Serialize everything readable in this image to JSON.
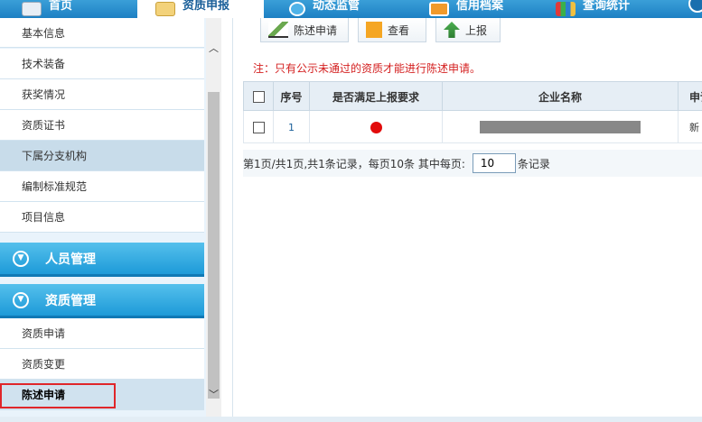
{
  "top_tabs": [
    {
      "label": "首页",
      "icon": "home-icon"
    },
    {
      "label": "资质申报",
      "icon": "pencil-icon"
    },
    {
      "label": "动态监管",
      "icon": "globe-icon"
    },
    {
      "label": "信用档案",
      "icon": "folder-icon"
    },
    {
      "label": "查询统计",
      "icon": "bar-chart-icon"
    }
  ],
  "sidebar": {
    "items_top": [
      {
        "label": "基本信息"
      },
      {
        "label": "技术装备"
      },
      {
        "label": "获奖情况"
      },
      {
        "label": "资质证书"
      },
      {
        "label": "下属分支机构"
      },
      {
        "label": "编制标准规范"
      },
      {
        "label": "项目信息"
      }
    ],
    "sections": [
      {
        "label": "人员管理"
      },
      {
        "label": "资质管理"
      }
    ],
    "items_bottom": [
      {
        "label": "资质申请"
      },
      {
        "label": "资质变更"
      },
      {
        "label": "陈述申请"
      }
    ]
  },
  "toolbar": {
    "statement_label": "陈述申请",
    "view_label": "查看",
    "report_label": "上报"
  },
  "notice": "注：只有公示未通过的资质才能进行陈述申请。",
  "table": {
    "columns": [
      "序号",
      "是否满足上报要求",
      "企业名称",
      "申请"
    ],
    "rows": [
      {
        "index": "1",
        "status_color": "#e20b0b",
        "last": "新"
      }
    ]
  },
  "pager": {
    "summary": "第1页/共1页,共1条记录，每页10条 其中每页:",
    "page_size": "10",
    "suffix": "条记录"
  },
  "colors": {
    "accent": "#1d9ad8",
    "notice_red": "#d42020",
    "highlight_frame": "#e0262a"
  }
}
